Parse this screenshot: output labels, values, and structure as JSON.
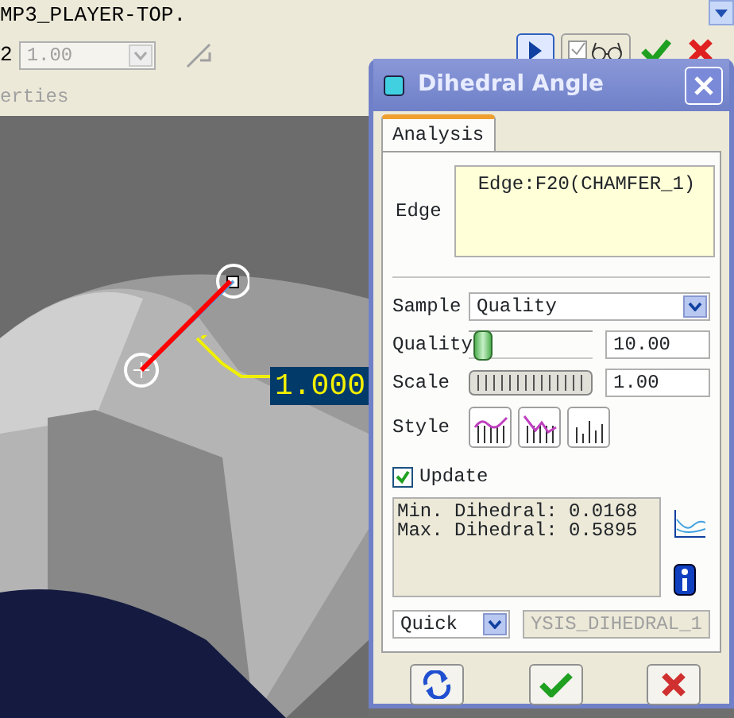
{
  "header": {
    "model_name": "MP3_PLAYER-TOP.",
    "row_label": "2",
    "scale_combo": {
      "value": "1.00",
      "disabled": true
    },
    "section_label": "erties"
  },
  "toolbar": [
    {
      "kind": "play",
      "pressed": true
    },
    {
      "kind": "preview",
      "pressed": false
    },
    {
      "kind": "ok"
    },
    {
      "kind": "cancel"
    }
  ],
  "viewport": {
    "dimension_label": "1.000"
  },
  "dialog": {
    "title": "Dihedral Angle",
    "tabs": [
      {
        "label": "Analysis",
        "selected": true
      }
    ],
    "edge": {
      "label": "Edge",
      "value": "Edge:F20(CHAMFER_1)"
    },
    "sample": {
      "label": "Sample",
      "value": "Quality"
    },
    "quality": {
      "label": "Quality",
      "level": 0.05,
      "value": "10.00"
    },
    "scale": {
      "label": "Scale",
      "value": "1.00"
    },
    "style": {
      "label": "Style",
      "options": [
        {
          "kind": "curve"
        },
        {
          "kind": "zigzag"
        },
        {
          "kind": "bars"
        }
      ]
    },
    "update": {
      "label": "Update",
      "checked": true
    },
    "results": [
      "Min. Dihedral: 0.0168",
      "Max. Dihedral: 0.5895"
    ],
    "mode": {
      "value": "Quick"
    },
    "name_field": {
      "value": "YSIS_DIHEDRAL_1",
      "disabled": true
    }
  }
}
